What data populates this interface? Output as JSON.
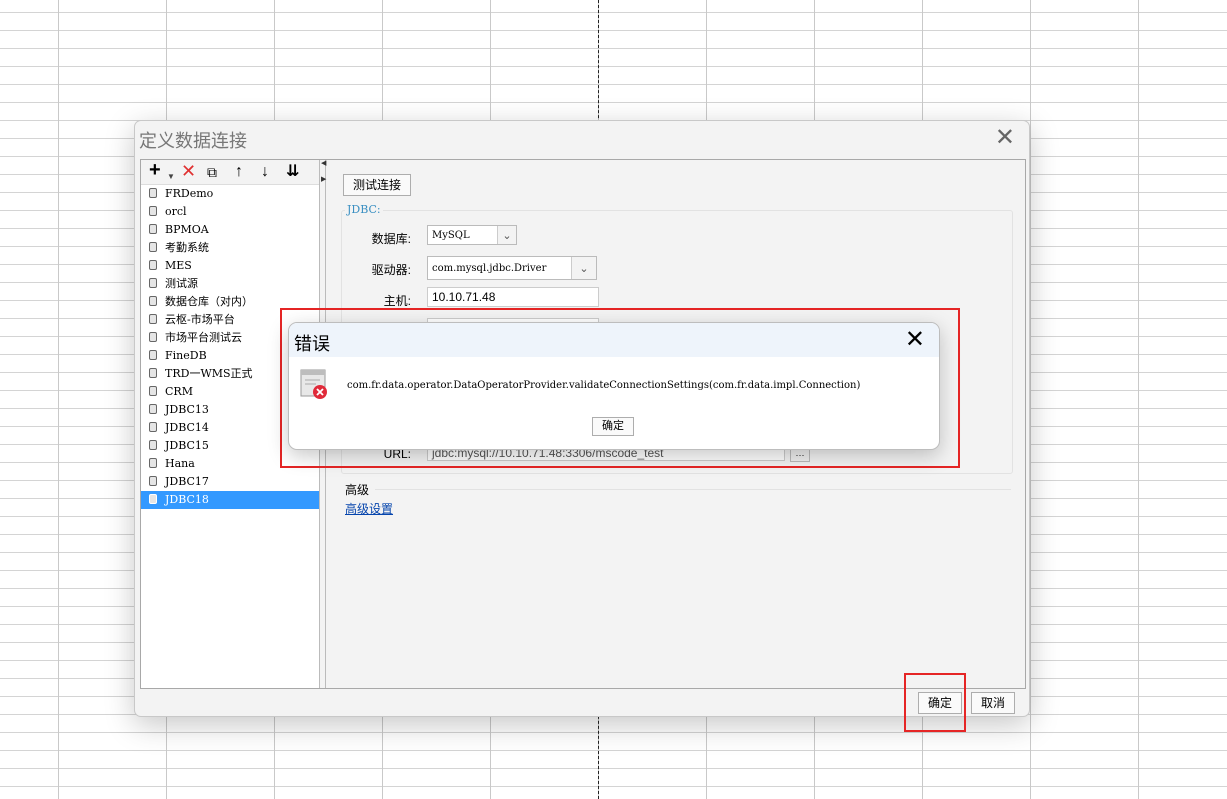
{
  "dialog": {
    "title": "定义数据连接",
    "close_glyph": "✕",
    "ok_label": "确定",
    "cancel_label": "取消"
  },
  "toolbar": {
    "add_icon": "add-icon",
    "delete_icon": "delete-icon",
    "copy_icon": "copy-icon",
    "move_up_icon": "arrow-up-icon",
    "move_down_icon": "arrow-down-icon",
    "sort_icon": "sort-icon"
  },
  "datasources": [
    {
      "name": "FRDemo"
    },
    {
      "name": "orcl"
    },
    {
      "name": "BPMOA"
    },
    {
      "name": "考勤系统"
    },
    {
      "name": "MES"
    },
    {
      "name": "测试源"
    },
    {
      "name": "数据仓库（对内）"
    },
    {
      "name": "云枢-市场平台"
    },
    {
      "name": "市场平台测试云"
    },
    {
      "name": "FineDB"
    },
    {
      "name": "TRD一WMS正式"
    },
    {
      "name": "CRM"
    },
    {
      "name": "JDBC13"
    },
    {
      "name": "JDBC14"
    },
    {
      "name": "JDBC15"
    },
    {
      "name": "Hana"
    },
    {
      "name": "JDBC17"
    },
    {
      "name": "JDBC18",
      "selected": true
    }
  ],
  "form": {
    "test_button": "测试连接",
    "group_title": "JDBC:",
    "database_label": "数据库:",
    "database_value": "MySQL",
    "driver_label": "驱动器:",
    "driver_value": "com.mysql.jdbc.Driver",
    "host_label": "主机:",
    "host_value": "10.10.71.48",
    "url_label": "URL:",
    "url_value": "jdbc:mysql://10.10.71.48:3306/mscode_test",
    "advanced_title": "高级",
    "advanced_link": "高级设置"
  },
  "error_dialog": {
    "title": "错误",
    "message": "com.fr.data.operator.DataOperatorProvider.validateConnectionSettings(com.fr.data.impl.Connection)",
    "ok_label": "确定",
    "icon": "error-icon"
  },
  "colors": {
    "selection": "#3399ff",
    "annotation_red": "#e52525",
    "link": "#0645ad"
  }
}
